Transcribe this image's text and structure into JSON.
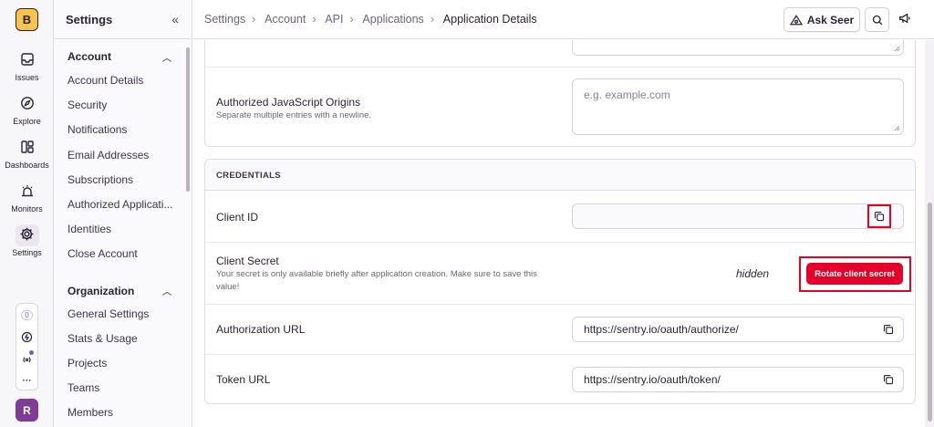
{
  "rail": {
    "org_initial": "B",
    "items": [
      {
        "label": "Issues",
        "icon": "inbox-icon"
      },
      {
        "label": "Explore",
        "icon": "compass-icon"
      },
      {
        "label": "Dashboards",
        "icon": "dashboard-icon"
      },
      {
        "label": "Monitors",
        "icon": "siren-icon"
      },
      {
        "label": "Settings",
        "icon": "gear-icon"
      }
    ],
    "badge_count": "0",
    "more": "···",
    "avatar_initial": "R"
  },
  "sidebar": {
    "title": "Settings",
    "collapse": "«",
    "account": {
      "heading": "Account",
      "items": [
        "Account Details",
        "Security",
        "Notifications",
        "Email Addresses",
        "Subscriptions",
        "Authorized Applicati...",
        "Identities",
        "Close Account"
      ]
    },
    "organization": {
      "heading": "Organization",
      "items": [
        "General Settings",
        "Stats & Usage",
        "Projects",
        "Teams",
        "Members"
      ]
    }
  },
  "topbar": {
    "breadcrumbs": [
      "Settings",
      "Account",
      "API",
      "Applications",
      "Application Details"
    ],
    "ask_label": "Ask Seer"
  },
  "form": {
    "js_origins": {
      "label": "Authorized JavaScript Origins",
      "help": "Separate multiple entries with a newline.",
      "placeholder": "e.g. example.com"
    }
  },
  "credentials": {
    "heading": "CREDENTIALS",
    "client_id": {
      "label": "Client ID",
      "value": ""
    },
    "client_secret": {
      "label": "Client Secret",
      "help": "Your secret is only available briefly after application creation. Make sure to save this value!",
      "value": "hidden",
      "rotate_label": "Rotate client secret"
    },
    "auth_url": {
      "label": "Authorization URL",
      "value": "https://sentry.io/oauth/authorize/"
    },
    "token_url": {
      "label": "Token URL",
      "value": "https://sentry.io/oauth/token/"
    }
  },
  "colors": {
    "accent": "#e4002b",
    "highlight": "#e8001e",
    "org_badge": "#f8c44a",
    "avatar": "#7f3c95"
  }
}
